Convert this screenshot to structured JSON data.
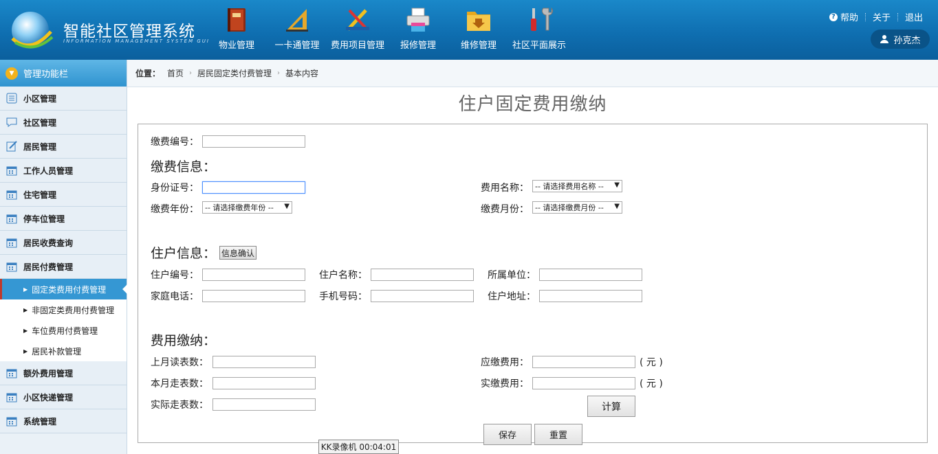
{
  "header": {
    "app_title": "智能社区管理系统",
    "app_subtitle": "INFORMATION MANAGEMENT SYSTEM GUI",
    "nav": [
      {
        "label": "物业管理",
        "icon": "book-icon"
      },
      {
        "label": "一卡通管理",
        "icon": "ruler-triangle-icon"
      },
      {
        "label": "费用项目管理",
        "icon": "tools-pencil-icon"
      },
      {
        "label": "报修管理",
        "icon": "printer-icon"
      },
      {
        "label": "维修管理",
        "icon": "folder-download-icon"
      },
      {
        "label": "社区平面展示",
        "icon": "screwdriver-wrench-icon"
      }
    ],
    "links": {
      "help": "帮助",
      "about": "关于",
      "logout": "退出"
    },
    "user": "孙克杰"
  },
  "sidebar": {
    "title": "管理功能栏",
    "items": [
      {
        "label": "小区管理"
      },
      {
        "label": "社区管理"
      },
      {
        "label": "居民管理"
      },
      {
        "label": "工作人员管理"
      },
      {
        "label": "住宅管理"
      },
      {
        "label": "停车位管理"
      },
      {
        "label": "居民收费查询"
      },
      {
        "label": "居民付费管理"
      }
    ],
    "sub_items": [
      {
        "label": "固定类费用付费管理",
        "active": true
      },
      {
        "label": "非固定类费用付费管理"
      },
      {
        "label": "车位费用付费管理"
      },
      {
        "label": "居民补款管理"
      }
    ],
    "items_after": [
      {
        "label": "额外费用管理"
      },
      {
        "label": "小区快递管理"
      },
      {
        "label": "系统管理"
      }
    ]
  },
  "breadcrumb": {
    "position_label": "位置：",
    "items": [
      "首页",
      "居民固定类付费管理",
      "基本内容"
    ]
  },
  "page_title": "住户固定费用缴纳",
  "form": {
    "payment_no": {
      "label": "缴费编号：",
      "value": ""
    },
    "section_payment": "缴费信息：",
    "id_card": {
      "label": "身份证号：",
      "value": ""
    },
    "fee_name": {
      "label": "费用名称：",
      "selected": "-- 请选择费用名称 --"
    },
    "pay_year": {
      "label": "缴费年份：",
      "selected": "-- 请选择缴费年份 --"
    },
    "pay_month": {
      "label": "缴费月份：",
      "selected": "-- 请选择缴费月份 --"
    },
    "section_resident": "住户信息：",
    "confirm_button": "信息确认",
    "resident_no": {
      "label": "住户编号：",
      "value": ""
    },
    "resident_name": {
      "label": "住户名称：",
      "value": ""
    },
    "unit": {
      "label": "所属单位：",
      "value": ""
    },
    "home_phone": {
      "label": "家庭电话：",
      "value": ""
    },
    "mobile": {
      "label": "手机号码：",
      "value": ""
    },
    "address": {
      "label": "住户地址：",
      "value": ""
    },
    "section_fee": "费用缴纳：",
    "last_reading": {
      "label": "上月读表数：",
      "value": ""
    },
    "this_usage": {
      "label": "本月走表数：",
      "value": ""
    },
    "actual_usage": {
      "label": "实际走表数：",
      "value": ""
    },
    "due_fee": {
      "label": "应缴费用：",
      "value": "",
      "unit": "( 元 )"
    },
    "paid_fee": {
      "label": "实缴费用：",
      "value": "",
      "unit": "( 元 )"
    },
    "calc_button": "计算",
    "save_button": "保存",
    "reset_button": "重置"
  },
  "recorder_overlay": "KK录像机 00:04:01",
  "colors": {
    "header": "#0f6fb1",
    "sidebar_active": "#3597d3",
    "accent_orange": "#f3b21a"
  }
}
